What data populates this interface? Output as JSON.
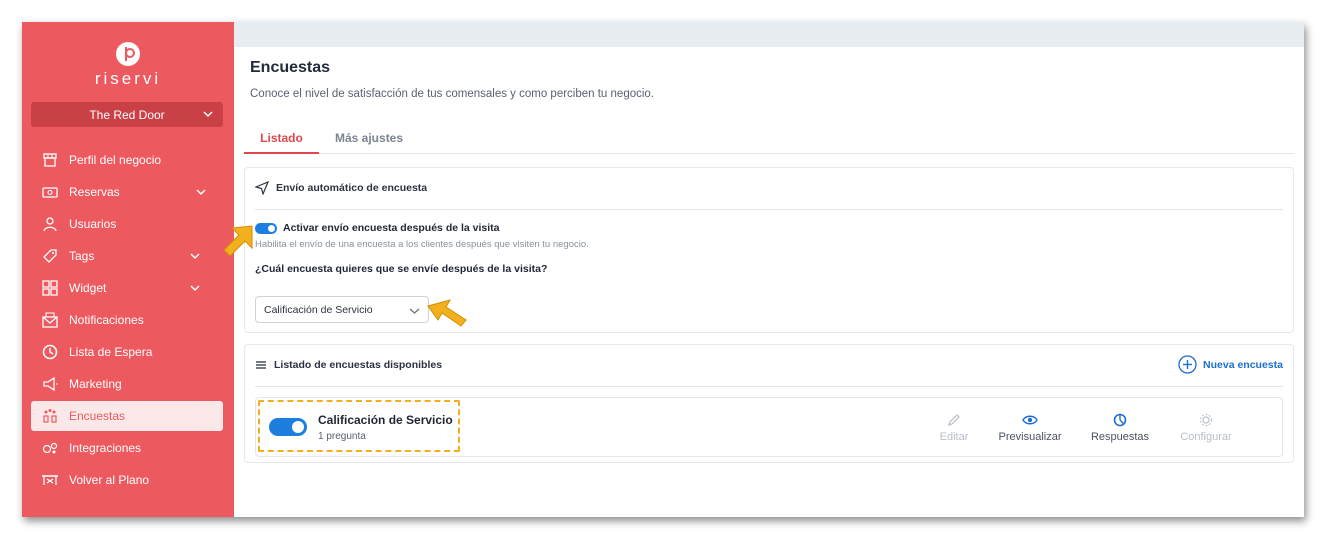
{
  "app": {
    "logo_text": "riservi"
  },
  "restaurant": {
    "name": "The Red Door"
  },
  "sidebar": {
    "items": [
      {
        "label": "Perfil del negocio",
        "icon": "store-icon"
      },
      {
        "label": "Reservas",
        "icon": "ticket-icon"
      },
      {
        "label": "Usuarios",
        "icon": "user-icon"
      },
      {
        "label": "Tags",
        "icon": "tag-icon"
      },
      {
        "label": "Widget",
        "icon": "grid-icon"
      },
      {
        "label": "Notificaciones",
        "icon": "mail-icon"
      },
      {
        "label": "Lista de Espera",
        "icon": "clock-icon"
      },
      {
        "label": "Marketing",
        "icon": "megaphone-icon"
      },
      {
        "label": "Encuestas",
        "icon": "survey-icon"
      },
      {
        "label": "Integraciones",
        "icon": "integrations-icon"
      },
      {
        "label": "Volver al Plano",
        "icon": "floor-plan-icon"
      }
    ]
  },
  "page": {
    "title": "Encuestas",
    "subtitle": "Conoce el nivel de satisfacción de tus comensales y como perciben tu negocio."
  },
  "tabs": [
    {
      "label": "Listado"
    },
    {
      "label": "Más ajustes"
    }
  ],
  "auto_send": {
    "header": "Envío automático de encuesta",
    "toggle_label": "Activar envío encuesta después de la visita",
    "help": "Habilita el envío de una encuesta a los clientes después que visiten tu negocio.",
    "question": "¿Cuál encuesta quieres que se envíe después de la visita?",
    "selected": "Calificación de Servicio"
  },
  "survey_list": {
    "header": "Listado de encuestas disponibles",
    "new_button": "Nueva encuesta",
    "items": [
      {
        "name": "Calificación de Servicio",
        "count": "1 pregunta",
        "actions": {
          "edit": "Editar",
          "preview": "Previsualizar",
          "responses": "Respuestas",
          "configure": "Configurar"
        }
      }
    ]
  },
  "colors": {
    "brand": "#ec5a5f",
    "accent": "#1c7fe0",
    "highlight": "#f2b01e"
  }
}
